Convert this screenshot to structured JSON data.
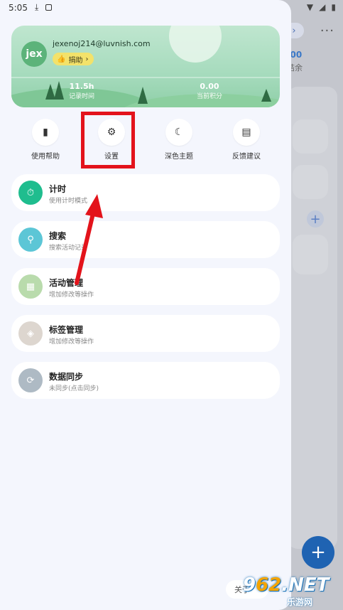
{
  "status_bar": {
    "time": "5:05"
  },
  "background": {
    "amount": ".00",
    "amount_label": "结余",
    "plus": "+",
    "fab": "+"
  },
  "profile": {
    "avatar_text": "jex",
    "email": "jexenoj214@luvnish.com",
    "donate_label": "捐助",
    "stats": [
      {
        "value": "11.5h",
        "label": "记录时间"
      },
      {
        "value": "0.00",
        "label": "当前积分"
      }
    ]
  },
  "quick_actions": [
    {
      "label": "使用帮助",
      "icon": "book-icon"
    },
    {
      "label": "设置",
      "icon": "gear-icon"
    },
    {
      "label": "深色主题",
      "icon": "moon-icon"
    },
    {
      "label": "反馈建议",
      "icon": "feedback-icon"
    }
  ],
  "menu_items": [
    {
      "title": "计时",
      "subtitle": "使用计时模式",
      "icon": "timer-icon",
      "color": "#1fbd8e"
    },
    {
      "title": "搜索",
      "subtitle": "搜索活动记录",
      "icon": "search-icon",
      "color": "#5cc6d6"
    },
    {
      "title": "活动管理",
      "subtitle": "增加修改等操作",
      "icon": "grid-icon",
      "color": "#b9dbac"
    },
    {
      "title": "标签管理",
      "subtitle": "增加修改等操作",
      "icon": "tag-icon",
      "color": "#ddd6cf"
    },
    {
      "title": "数据同步",
      "subtitle": "未同步(点击同步)",
      "icon": "sync-icon",
      "color": "#aebac4"
    }
  ],
  "about_label": "关于",
  "watermark": {
    "brand_a": "9",
    "brand_b": "62",
    "brand_c": ".NET",
    "sub": "乐游网"
  },
  "colors": {
    "highlight": "#e3131b",
    "arrow": "#e3131b",
    "fab": "#1f63b2"
  }
}
